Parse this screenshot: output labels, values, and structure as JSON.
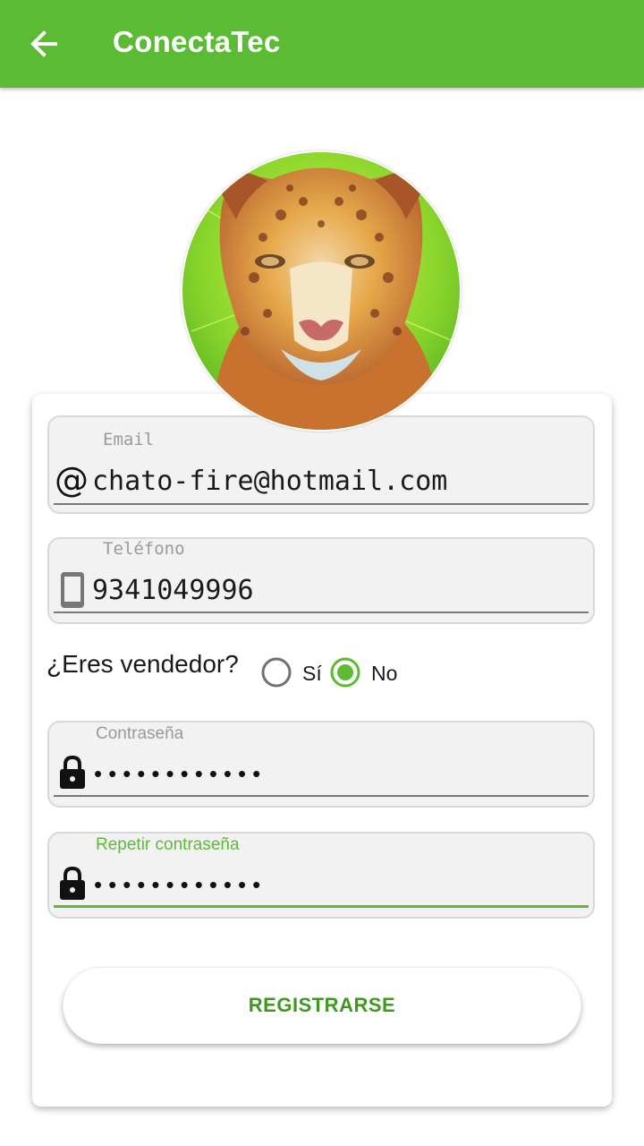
{
  "appbar": {
    "title": "ConectaTec",
    "back_icon": "arrow-back-icon",
    "color": "#5cbb35"
  },
  "profile": {
    "avatar_icon": "jaguar-avatar"
  },
  "form": {
    "email": {
      "label": "Email",
      "value": "chato-fire@hotmail.com",
      "icon": "at-sign-icon"
    },
    "phone": {
      "label": "Teléfono",
      "value": "9341049996",
      "icon": "phone-icon"
    },
    "seller": {
      "question": "¿Eres vendedor?",
      "options": [
        {
          "label": "Sí",
          "selected": false
        },
        {
          "label": "No",
          "selected": true
        }
      ]
    },
    "password": {
      "label": "Contraseña",
      "value": "••••••••••••",
      "icon": "lock-icon"
    },
    "repeat_password": {
      "label": "Repetir contraseña",
      "value": "••••••••••••",
      "icon": "lock-icon",
      "focused": true
    }
  },
  "actions": {
    "register_label": "REGISTRARSE"
  },
  "colors": {
    "accent": "#5cbb35",
    "button_text": "#3d9a1e"
  }
}
